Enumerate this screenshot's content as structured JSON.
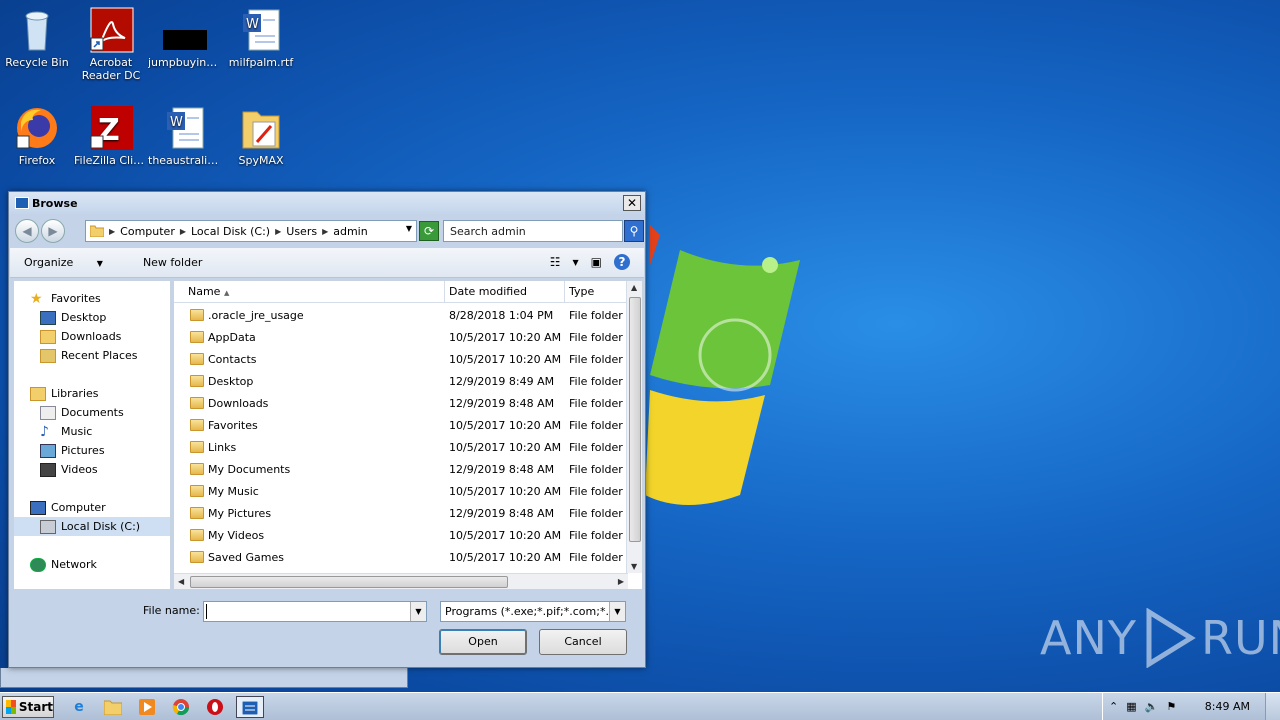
{
  "desktop": {
    "icons": [
      {
        "label": "Recycle Bin",
        "icon": "recycle-bin-icon"
      },
      {
        "label": "Acrobat Reader DC",
        "label1": "Acrobat",
        "label2": "Reader DC",
        "icon": "acrobat-icon"
      },
      {
        "label": "jumpbuying...",
        "icon": "black-file-icon"
      },
      {
        "label": "milfpalm.rtf",
        "icon": "word-doc-icon"
      },
      {
        "label": "Firefox",
        "icon": "firefox-icon"
      },
      {
        "label": "FileZilla Client",
        "icon": "filezilla-icon"
      },
      {
        "label": "theaustralia...",
        "icon": "word-doc-icon"
      },
      {
        "label": "SpyMAX",
        "icon": "folder-icon"
      }
    ],
    "watermark": "ANY RUN",
    "watermark_left": "ANY",
    "watermark_right": "RUN"
  },
  "dialog": {
    "title": "Browse",
    "close": "✕",
    "back": "◀",
    "forward": "▶",
    "breadcrumb": [
      "Computer",
      "Local Disk (C:)",
      "Users",
      "admin"
    ],
    "search_placeholder": "Search admin",
    "toolbar": {
      "organize": "Organize",
      "new_folder": "New folder",
      "help": "?"
    },
    "nav": {
      "favorites": "Favorites",
      "desktop": "Desktop",
      "downloads": "Downloads",
      "recent": "Recent Places",
      "libraries": "Libraries",
      "documents": "Documents",
      "music": "Music",
      "pictures": "Pictures",
      "videos": "Videos",
      "computer": "Computer",
      "localdisk": "Local Disk (C:)",
      "network": "Network"
    },
    "columns": {
      "name": "Name",
      "date": "Date modified",
      "type": "Type"
    },
    "files": [
      {
        "name": ".oracle_jre_usage",
        "date": "8/28/2018 1:04 PM",
        "type": "File folder"
      },
      {
        "name": "AppData",
        "date": "10/5/2017 10:20 AM",
        "type": "File folder"
      },
      {
        "name": "Contacts",
        "date": "10/5/2017 10:20 AM",
        "type": "File folder"
      },
      {
        "name": "Desktop",
        "date": "12/9/2019 8:49 AM",
        "type": "File folder"
      },
      {
        "name": "Downloads",
        "date": "12/9/2019 8:48 AM",
        "type": "File folder"
      },
      {
        "name": "Favorites",
        "date": "10/5/2017 10:20 AM",
        "type": "File folder"
      },
      {
        "name": "Links",
        "date": "10/5/2017 10:20 AM",
        "type": "File folder"
      },
      {
        "name": "My Documents",
        "date": "12/9/2019 8:48 AM",
        "type": "File folder"
      },
      {
        "name": "My Music",
        "date": "10/5/2017 10:20 AM",
        "type": "File folder"
      },
      {
        "name": "My Pictures",
        "date": "12/9/2019 8:48 AM",
        "type": "File folder"
      },
      {
        "name": "My Videos",
        "date": "10/5/2017 10:20 AM",
        "type": "File folder"
      },
      {
        "name": "Saved Games",
        "date": "10/5/2017 10:20 AM",
        "type": "File folder"
      }
    ],
    "file_name_label": "File name:",
    "file_name_value": "",
    "filter": "Programs (*.exe;*.pif;*.com;*.ba",
    "open": "Open",
    "cancel": "Cancel"
  },
  "taskbar": {
    "start": "Start",
    "clock": "8:49 AM"
  },
  "colors": {
    "accent": "#2e6fd0",
    "desktop": "#1565c4",
    "dialog_frame": "#c4d3e8"
  }
}
